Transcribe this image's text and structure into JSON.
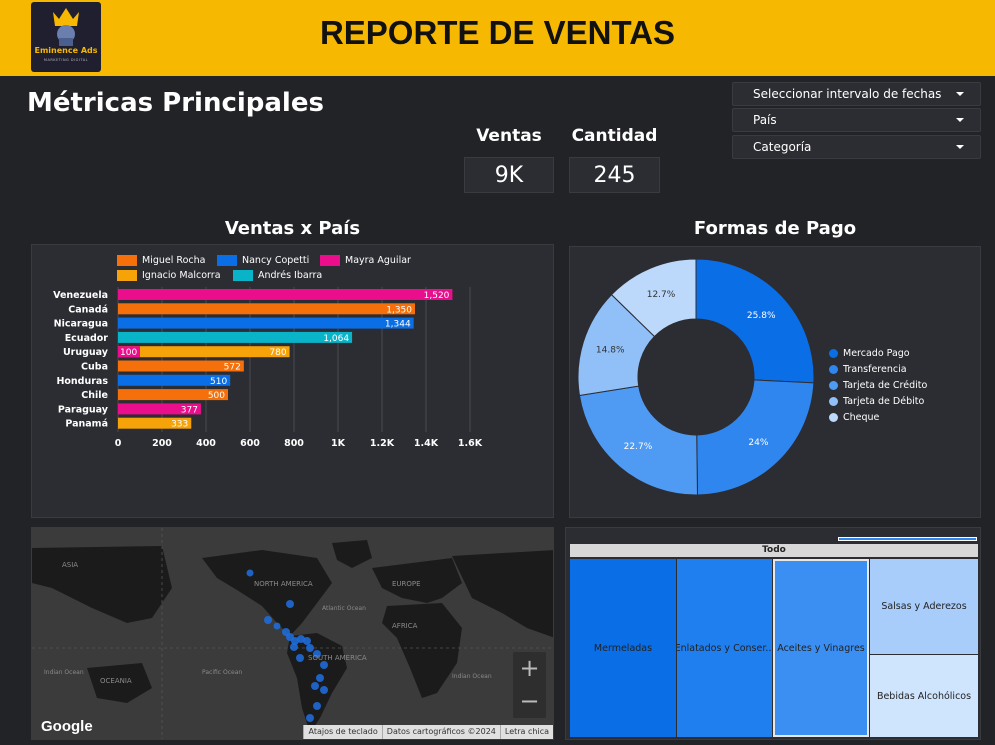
{
  "header": {
    "logo_text": "Eminence Ads",
    "logo_sub": "MARKETING DIGITAL",
    "title": "REPORTE DE VENTAS"
  },
  "metrics": {
    "title": "Métricas Principales",
    "kpis": [
      {
        "label": "Ventas",
        "value": "9K"
      },
      {
        "label": "Cantidad",
        "value": "245"
      }
    ]
  },
  "filters": [
    {
      "label": "Seleccionar intervalo de fechas"
    },
    {
      "label": "País"
    },
    {
      "label": "Categoría"
    }
  ],
  "sales_by_country": {
    "title": "Ventas x País"
  },
  "payment_methods": {
    "title": "Formas de Pago"
  },
  "map": {
    "labels": [
      "ASIA",
      "NORTH AMERICA",
      "EUROPE",
      "AFRICA",
      "SOUTH AMERICA",
      "OCEANIA",
      "Atlantic Ocean",
      "Indian Ocean",
      "Pacific Ocean",
      "Indian Ocean"
    ],
    "zoom_in": "+",
    "zoom_out": "−",
    "brand": "Google",
    "footer": [
      "Atajos de teclado",
      "Datos cartográficos ©2024",
      "Letra chica"
    ]
  },
  "treemap": {
    "root": "Todo",
    "cells": [
      {
        "label": "Mermeladas",
        "color": "#0a6ee6"
      },
      {
        "label": "Enlatados y Conser...",
        "color": "#1f7fef"
      },
      {
        "label": "Aceites y Vinagres",
        "color": "#3b8ff2"
      },
      {
        "label": "Salsas y Aderezos",
        "color": "#a9cdfb"
      },
      {
        "label": "Bebidas Alcohólicos",
        "color": "#cfe4fd"
      }
    ]
  },
  "chart_data": [
    {
      "type": "bar",
      "orientation": "horizontal",
      "categories": [
        "Venezuela",
        "Canadá",
        "Nicaragua",
        "Ecuador",
        "Uruguay",
        "Cuba",
        "Honduras",
        "Chile",
        "Paraguay",
        "Panamá"
      ],
      "values": [
        1520,
        1350,
        1344,
        1064,
        780,
        572,
        510,
        500,
        377,
        333
      ],
      "data_labels": [
        "1,520",
        "1,350",
        "1,344",
        "1,064",
        "780",
        "572",
        "510",
        "500",
        "377",
        "333"
      ],
      "bar_series": [
        "Mayra Aguilar",
        "Miguel Rocha",
        "Nancy Copetti",
        "Andrés Ibarra",
        "Ignacio Malcorra",
        "Miguel Rocha",
        "Nancy Copetti",
        "Miguel Rocha",
        "Mayra Aguilar",
        "Ignacio Malcorra"
      ],
      "secondary": [
        {
          "category": "Uruguay",
          "series": "Mayra Aguilar",
          "value": 100
        }
      ],
      "series": [
        {
          "name": "Miguel Rocha",
          "color": "#f56f0a"
        },
        {
          "name": "Nancy Copetti",
          "color": "#0a6ee6"
        },
        {
          "name": "Mayra Aguilar",
          "color": "#ea0d8c"
        },
        {
          "name": "Ignacio Malcorra",
          "color": "#f6a30a"
        },
        {
          "name": "Andrés Ibarra",
          "color": "#0ab4c8"
        }
      ],
      "xlim": [
        0,
        1600
      ],
      "xticks": [
        0,
        200,
        400,
        600,
        800,
        1000,
        1200,
        1400,
        1600
      ],
      "xtick_labels": [
        "0",
        "200",
        "400",
        "600",
        "800",
        "1K",
        "1.2K",
        "1.4K",
        "1.6K"
      ],
      "legend": "top",
      "grid": true
    },
    {
      "type": "pie",
      "donut": true,
      "labels": [
        "Mercado Pago",
        "Transferencia",
        "Tarjeta de Crédito",
        "Tarjeta de Débito",
        "Cheque"
      ],
      "values": [
        25.8,
        24,
        22.7,
        14.8,
        12.7
      ],
      "value_labels": [
        "25.8%",
        "24%",
        "22.7%",
        "14.8%",
        "12.7%"
      ],
      "colors": [
        "#0a6ee6",
        "#2f86ee",
        "#4f9af2",
        "#90c0f7",
        "#bcd9fb"
      ],
      "legend": "right"
    }
  ]
}
